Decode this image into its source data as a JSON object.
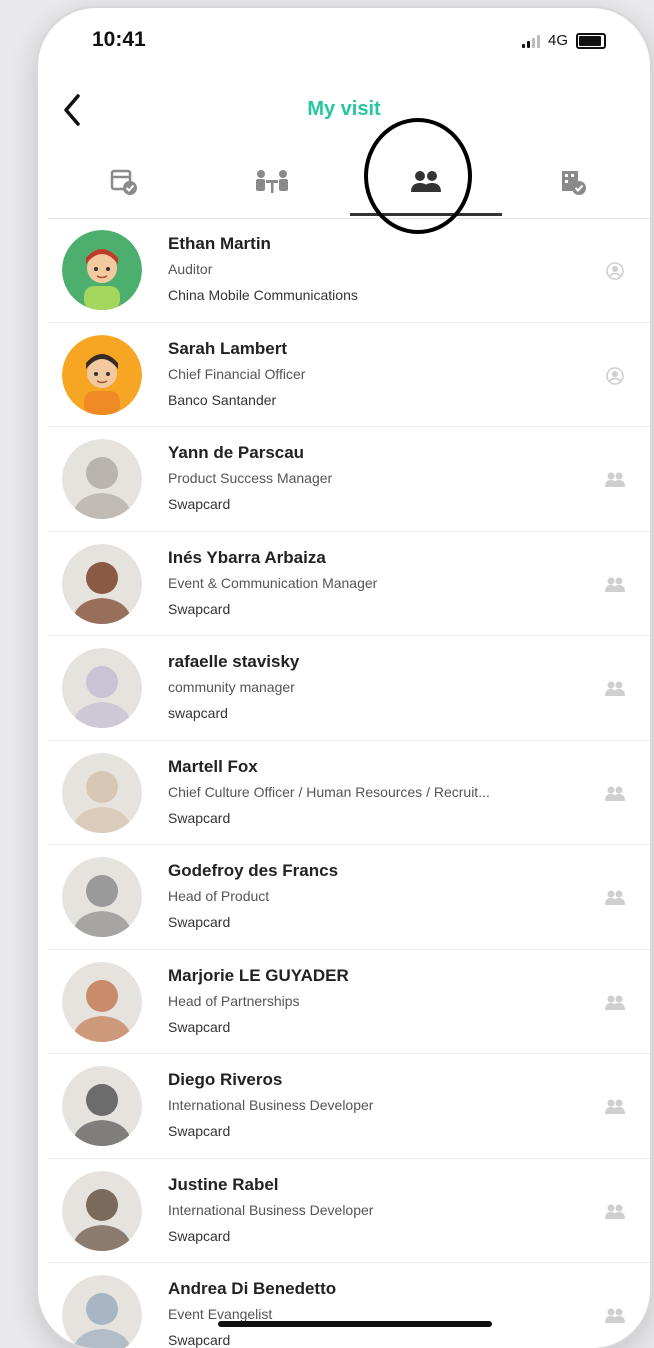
{
  "status_bar": {
    "time": "10:41",
    "network": "4G"
  },
  "header": {
    "title": "My visit",
    "back_icon": "chevron-left-icon"
  },
  "tabs": [
    {
      "icon": "calendar-check-icon",
      "active": false
    },
    {
      "icon": "meeting-table-icon",
      "active": false
    },
    {
      "icon": "people-icon",
      "active": true
    },
    {
      "icon": "building-check-icon",
      "active": false
    }
  ],
  "colors": {
    "accent": "#23c7a0",
    "text": "#222222",
    "muted": "#555555"
  },
  "contacts": [
    {
      "name": "Ethan Martin",
      "job": "Auditor",
      "company": "China Mobile Communications",
      "avatar": "illustrated-avatar",
      "badge": "contact-placeholder-icon"
    },
    {
      "name": "Sarah Lambert",
      "job": "Chief Financial Officer",
      "company": "Banco Santander",
      "avatar": "illustrated-avatar",
      "badge": "contact-placeholder-icon"
    },
    {
      "name": "Yann de Parscau",
      "job": "Product Success Manager",
      "company": "Swapcard",
      "avatar": "photo-avatar",
      "badge": "people-icon"
    },
    {
      "name": "Inés Ybarra Arbaiza",
      "job": "Event & Communication Manager",
      "company": "Swapcard",
      "avatar": "photo-avatar",
      "badge": "people-icon"
    },
    {
      "name": "rafaelle stavisky",
      "job": "community manager",
      "company": "swapcard",
      "avatar": "photo-avatar",
      "badge": "people-icon"
    },
    {
      "name": "Martell Fox",
      "job": "Chief Culture Officer / Human Resources / Recruit...",
      "company": "Swapcard",
      "avatar": "photo-avatar",
      "badge": "people-icon"
    },
    {
      "name": "Godefroy des Francs",
      "job": "Head of Product",
      "company": "Swapcard",
      "avatar": "photo-avatar",
      "badge": "people-icon"
    },
    {
      "name": "Marjorie LE GUYADER",
      "job": "Head of Partnerships",
      "company": "Swapcard",
      "avatar": "photo-avatar",
      "badge": "people-icon"
    },
    {
      "name": "Diego Riveros",
      "job": "International Business Developer",
      "company": "Swapcard",
      "avatar": "photo-avatar",
      "badge": "people-icon"
    },
    {
      "name": "Justine Rabel",
      "job": "International Business Developer",
      "company": "Swapcard",
      "avatar": "photo-avatar",
      "badge": "people-icon"
    },
    {
      "name": "Andrea Di Benedetto",
      "job": "Event Evangelist",
      "company": "Swapcard",
      "avatar": "photo-avatar",
      "badge": "people-icon"
    }
  ]
}
